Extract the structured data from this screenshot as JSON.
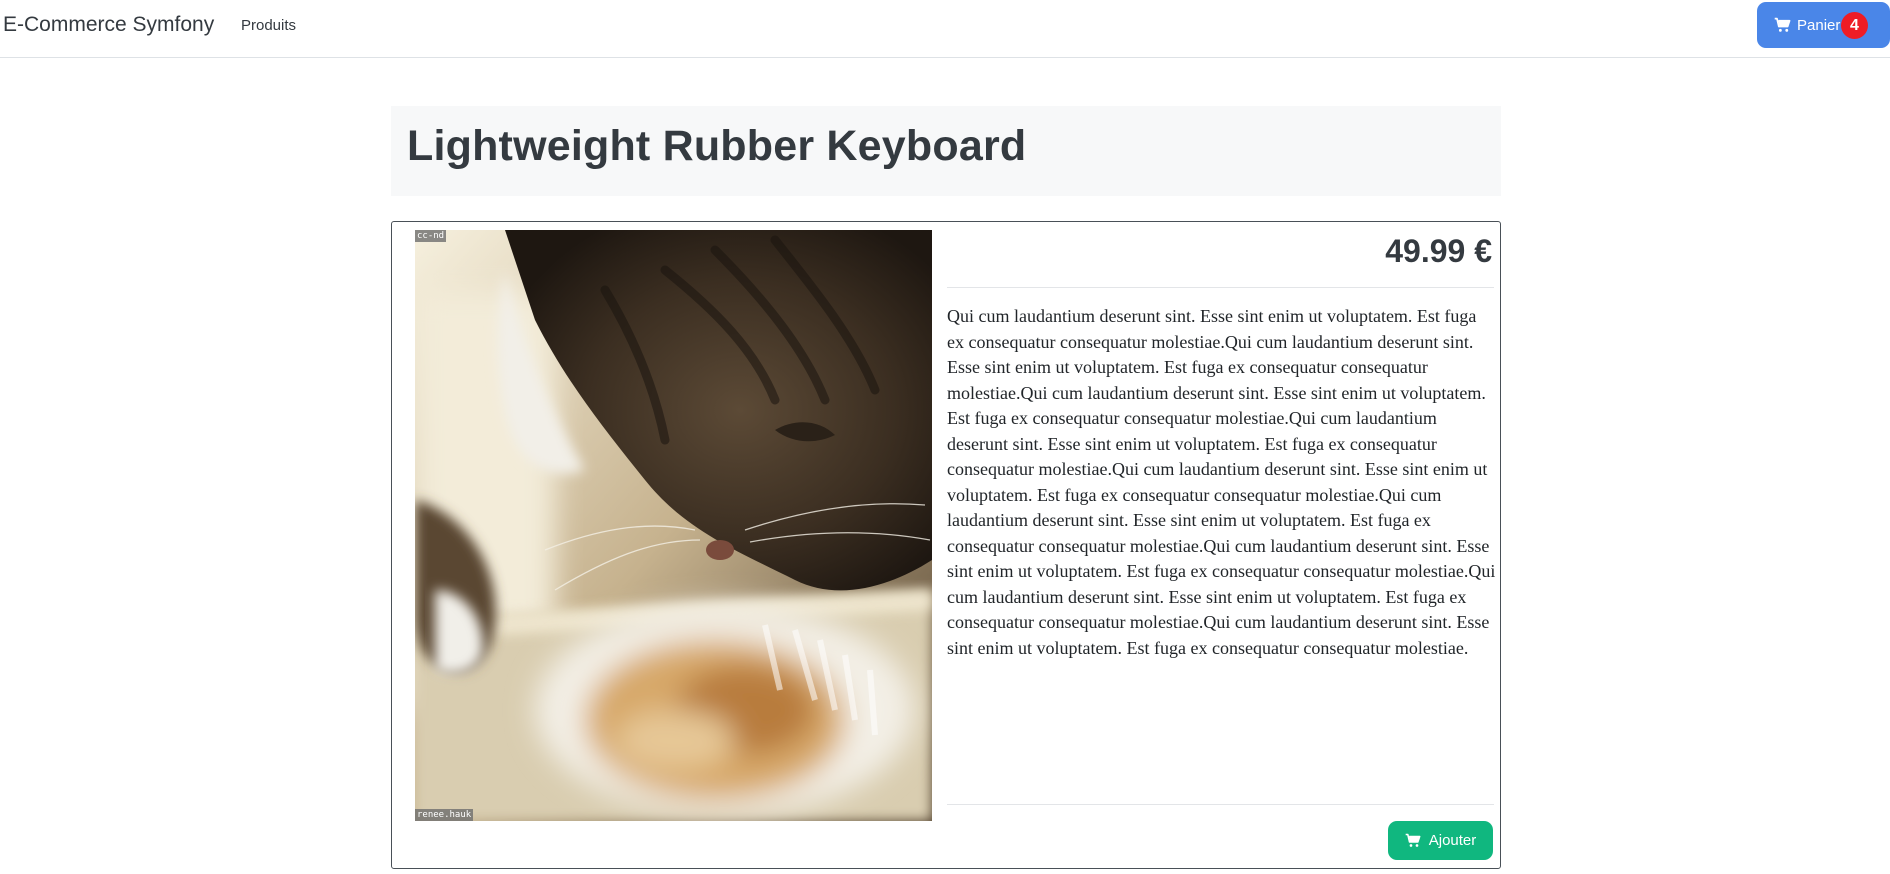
{
  "navbar": {
    "brand": "E-Commerce Symfony",
    "nav_links": [
      {
        "label": "Produits"
      }
    ],
    "cart": {
      "label": "Panier",
      "count": "4",
      "icon": "cart-icon",
      "color": "#4a86e8",
      "badge_color": "#ee1c25"
    }
  },
  "product": {
    "title": "Lightweight Rubber Keyboard",
    "price": "49.99 €",
    "image": {
      "license_label": "cc-nd",
      "author_label": "renee.hauk",
      "subject": "tabby cat sniffing a cupcake"
    },
    "description": "Qui cum laudantium deserunt sint. Esse sint enim ut voluptatem. Est fuga ex consequatur consequatur molestiae.Qui cum laudantium deserunt sint. Esse sint enim ut voluptatem. Est fuga ex consequatur consequatur molestiae.Qui cum laudantium deserunt sint. Esse sint enim ut voluptatem. Est fuga ex consequatur consequatur molestiae.Qui cum laudantium deserunt sint. Esse sint enim ut voluptatem. Est fuga ex consequatur consequatur molestiae.Qui cum laudantium deserunt sint. Esse sint enim ut voluptatem. Est fuga ex consequatur consequatur molestiae.Qui cum laudantium deserunt sint. Esse sint enim ut voluptatem. Est fuga ex consequatur consequatur molestiae.Qui cum laudantium deserunt sint. Esse sint enim ut voluptatem. Est fuga ex consequatur consequatur molestiae.Qui cum laudantium deserunt sint. Esse sint enim ut voluptatem. Est fuga ex consequatur consequatur molestiae.Qui cum laudantium deserunt sint. Esse sint enim ut voluptatem. Est fuga ex consequatur consequatur molestiae.",
    "add_button": {
      "label": "Ajouter",
      "icon": "cart-icon",
      "color": "#10b77f"
    }
  }
}
